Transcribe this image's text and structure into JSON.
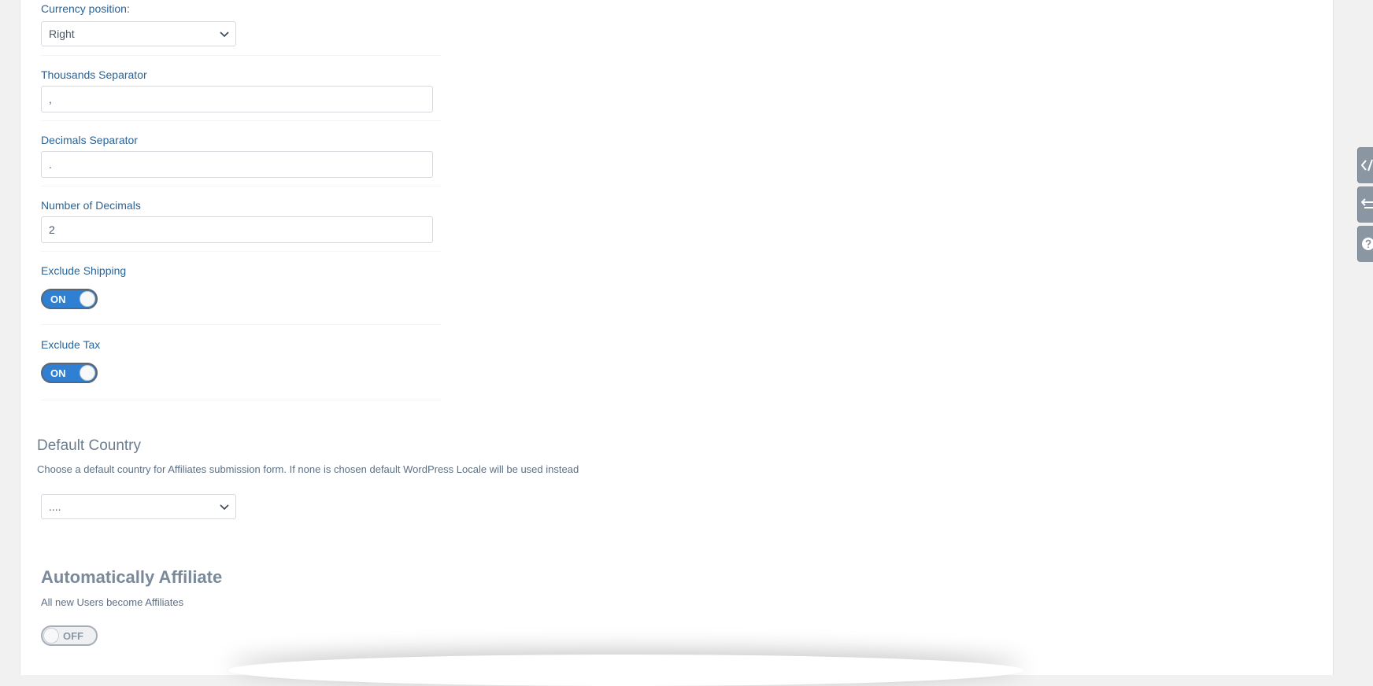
{
  "currency_position": {
    "label": "Currency position:",
    "value": "Right"
  },
  "thousands_separator": {
    "label": "Thousands Separator",
    "value": ","
  },
  "decimals_separator": {
    "label": "Decimals Separator",
    "value": "."
  },
  "number_of_decimals": {
    "label": "Number of Decimals",
    "value": "2"
  },
  "exclude_shipping": {
    "label": "Exclude Shipping",
    "state": "ON"
  },
  "exclude_tax": {
    "label": "Exclude Tax",
    "state": "ON"
  },
  "default_country": {
    "title": "Default Country",
    "description": "Choose a default country for Affiliates submission form. If none is chosen default WordPress Locale will be used instead",
    "value": "...."
  },
  "auto_affiliate": {
    "title": "Automatically Affiliate",
    "description": "All new Users become Affiliates",
    "state": "OFF"
  },
  "side_tabs": [
    "code-icon",
    "import-export-icon",
    "help-icon"
  ],
  "colors": {
    "accent": "#2f7fd3",
    "label": "#2a6496",
    "tab": "#8a97a3"
  }
}
